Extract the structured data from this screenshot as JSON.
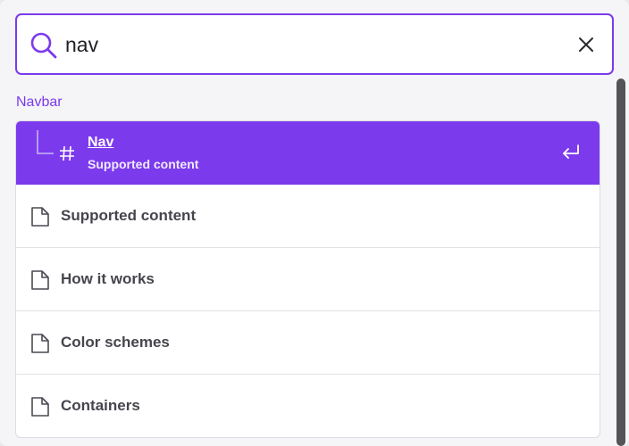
{
  "search": {
    "value": "nav",
    "icon": "search-icon",
    "clear_icon": "close-icon"
  },
  "group": {
    "title": "Navbar"
  },
  "selected_hit": {
    "title": "Nav",
    "subtitle": "Supported content",
    "icon": "hash-icon",
    "action_icon": "enter-icon"
  },
  "hits": [
    {
      "title": "Supported content",
      "icon": "document-icon"
    },
    {
      "title": "How it works",
      "icon": "document-icon"
    },
    {
      "title": "Color schemes",
      "icon": "document-icon"
    },
    {
      "title": "Containers",
      "icon": "document-icon"
    }
  ],
  "colors": {
    "accent": "#7c3aed",
    "scrollbar": "#545458"
  }
}
